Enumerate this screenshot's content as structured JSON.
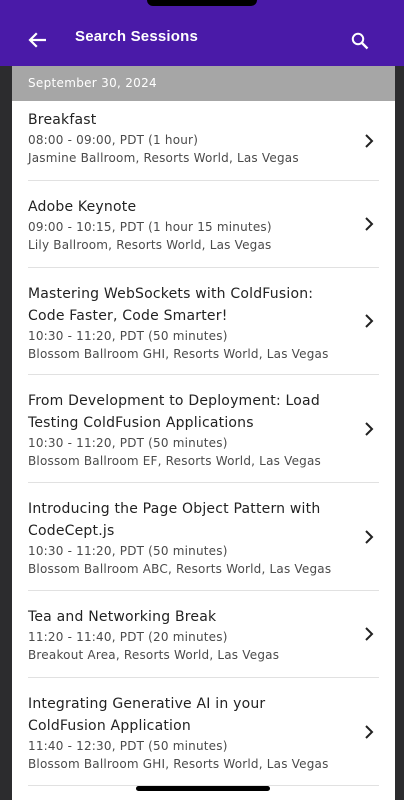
{
  "header": {
    "title": "Search Sessions",
    "back_icon": "arrow-back-icon",
    "search_icon": "search-icon",
    "bar_color": "#4a1aa8"
  },
  "date_header": "September 30, 2024",
  "sessions": [
    {
      "title": "Breakfast",
      "time": "08:00 - 09:00, PDT (1 hour)",
      "location": "Jasmine Ballroom, Resorts World, Las Vegas"
    },
    {
      "title": "Adobe Keynote",
      "time": "09:00 - 10:15, PDT (1 hour 15 minutes)",
      "location": "Lily Ballroom, Resorts World, Las Vegas"
    },
    {
      "title": "Mastering WebSockets with ColdFusion: Code Faster, Code Smarter!",
      "time": "10:30 - 11:20, PDT (50 minutes)",
      "location": "Blossom Ballroom GHI, Resorts World, Las Vegas"
    },
    {
      "title": "From Development to Deployment: Load Testing ColdFusion Applications",
      "time": "10:30 - 11:20, PDT (50 minutes)",
      "location": "Blossom Ballroom EF, Resorts World, Las Vegas"
    },
    {
      "title": "Introducing the Page Object Pattern with CodeCept.js",
      "time": "10:30 - 11:20, PDT (50 minutes)",
      "location": "Blossom Ballroom ABC, Resorts World, Las Vegas"
    },
    {
      "title": "Tea and Networking Break",
      "time": "11:20 - 11:40, PDT (20 minutes)",
      "location": "Breakout Area, Resorts World, Las Vegas"
    },
    {
      "title": "Integrating Generative AI in your ColdFusion Application",
      "time": "11:40 - 12:30, PDT (50 minutes)",
      "location": "Blossom Ballroom GHI, Resorts World, Las Vegas"
    }
  ]
}
